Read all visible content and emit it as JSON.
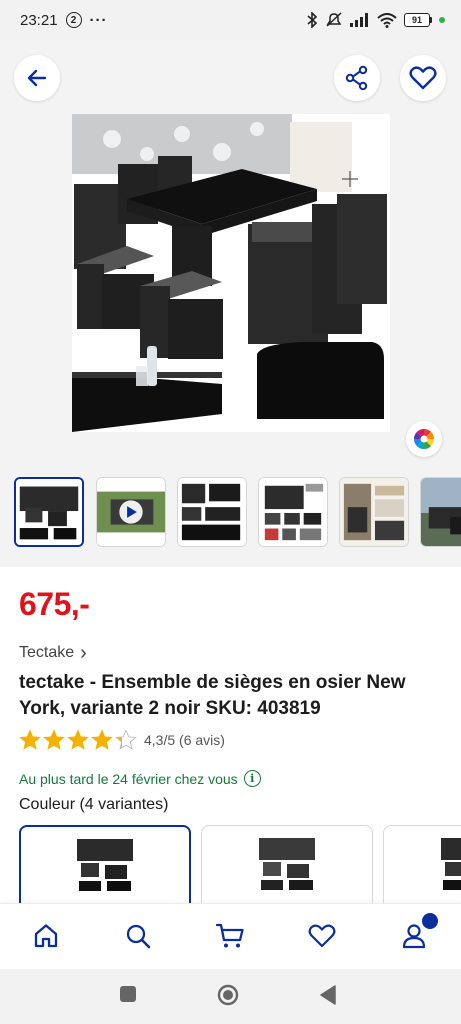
{
  "status_bar": {
    "time": "23:21",
    "notification_count": "2",
    "more": "···",
    "battery": "91"
  },
  "gallery": {
    "icons": [
      "back-arrow-icon",
      "share-icon",
      "heart-icon",
      "color-wheel-icon",
      "play-icon"
    ],
    "thumbnail_count": 6,
    "selected_thumbnail": 1
  },
  "product": {
    "price": "675,-",
    "brand": "Tectake",
    "brand_chevron": "›",
    "title": "tectake - Ensemble de sièges en osier New York, variante 2 noir SKU: 403819",
    "rating_value": 4.3,
    "rating_text": "4,3/5 (6 avis)",
    "delivery": "Au plus tard le 24 février chez vous",
    "variants_heading": "Couleur (4 variantes)"
  },
  "bottom_nav": {
    "items": [
      "home-icon",
      "search-icon",
      "cart-icon",
      "wishlist-icon",
      "account-icon"
    ],
    "active": "home-icon"
  },
  "colors": {
    "price_red": "#e1131a",
    "brand_blue": "#0b2e9e",
    "delivery_green": "#157a3d",
    "star_gold": "#f5b301"
  }
}
